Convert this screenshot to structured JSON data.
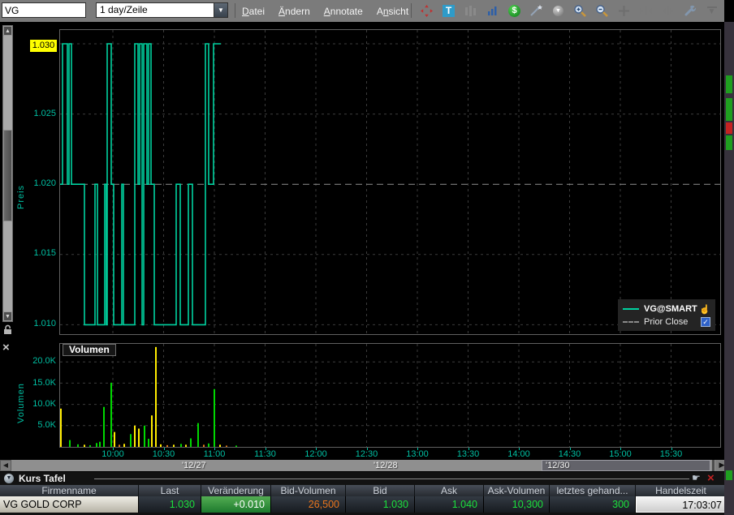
{
  "toolbar": {
    "symbol_value": "VG",
    "timeframe_value": "1 day/Zeile",
    "menus": [
      {
        "label": "Datei",
        "hotkey_index": 0
      },
      {
        "label": "Ändern",
        "hotkey_index": 0
      },
      {
        "label": "Annotate",
        "hotkey_index": 0
      },
      {
        "label": "Ansicht",
        "hotkey_index": 1
      }
    ],
    "icons": [
      "pan-icon",
      "text-annotate-icon",
      "bar-style-icon",
      "volume-style-icon",
      "dollar-icon",
      "trendline-icon",
      "trendline-menu-icon",
      "zoom-in-icon",
      "zoom-out-icon",
      "crosshair-icon",
      "expand-spacing-icon",
      "compress-spacing-icon",
      "settings-wrench-icon",
      "more-tools-icon"
    ]
  },
  "price_pane": {
    "ylabel": "Preis",
    "current_price_tag": "1.030",
    "ytick_labels": [
      "1.025",
      "1.020",
      "1.015",
      "1.010"
    ],
    "legend": {
      "series_label": "VG@SMART",
      "reference_label": "Prior Close",
      "reference_checked": true
    }
  },
  "volume_pane": {
    "title": "Volumen",
    "ylabel": "Volumen",
    "ytick_labels": [
      "20.0K",
      "15.0K",
      "10.0K",
      "5.0K"
    ]
  },
  "time_axis": {
    "labels": [
      "10:00",
      "10:30",
      "11:00",
      "11:30",
      "12:00",
      "12:30",
      "13:00",
      "13:30",
      "14:00",
      "14:30",
      "15:00",
      "15:30"
    ]
  },
  "date_axis": {
    "labels": [
      {
        "text": "'12/27",
        "x": 224
      },
      {
        "text": "'12/28",
        "x": 460
      },
      {
        "text": "'12/30",
        "x": 672
      }
    ]
  },
  "quote_panel": {
    "title": "Kurs Tafel",
    "columns": [
      "Firmenname",
      "Last",
      "Veränderung",
      "Bid-Volumen",
      "Bid",
      "Ask",
      "Ask-Volumen",
      "letztes gehand...",
      "Handelszeit"
    ],
    "row": {
      "firmenname": "VG GOLD CORP",
      "last": "1.030",
      "veraenderung": "+0.010",
      "bid_volumen": "26,500",
      "bid": "1.030",
      "ask": "1.040",
      "ask_volumen": "10,300",
      "letztes_gehandelt": "300",
      "handelszeit": "17:03:07"
    }
  },
  "colors": {
    "line_teal": "#00d2a0",
    "axis_teal": "#00bfa2",
    "bar_green": "#00d800",
    "bar_yellow": "#ffec00",
    "bar_orange": "#e07818",
    "quote_green": "#1be03c",
    "quote_orange": "#e8741c",
    "change_bg_green": "#2f9e3f",
    "tag_yellow": "#ffff00"
  },
  "chart_data": [
    {
      "type": "line",
      "title": "Preis",
      "ylim": [
        1.008,
        1.0315
      ],
      "yticks": [
        1.03,
        1.025,
        1.02,
        1.015,
        1.01
      ],
      "reference": {
        "name": "Prior Close",
        "value": 1.02
      },
      "tick_x": [
        66,
        128.5,
        191,
        253.5,
        316,
        378.5,
        441,
        503.5,
        566,
        628.5,
        691,
        753.5
      ],
      "series": [
        {
          "name": "VG@SMART",
          "end_x": 199,
          "step_points": [
            [
              0,
              1.02
            ],
            [
              4,
              1.03
            ],
            [
              10,
              1.02
            ],
            [
              12,
              1.03
            ],
            [
              15,
              1.02
            ],
            [
              31,
              1.01
            ],
            [
              44,
              1.02
            ],
            [
              47,
              1.01
            ],
            [
              56,
              1.02
            ],
            [
              58,
              1.01
            ],
            [
              59,
              1.03
            ],
            [
              64,
              1.02
            ],
            [
              67,
              1.01
            ],
            [
              77,
              1.02
            ],
            [
              79,
              1.01
            ],
            [
              93,
              1.03
            ],
            [
              97,
              1.02
            ],
            [
              99,
              1.03
            ],
            [
              102,
              1.01
            ],
            [
              104,
              1.03
            ],
            [
              108,
              1.02
            ],
            [
              110,
              1.03
            ],
            [
              113,
              1.02
            ],
            [
              117,
              1.01
            ],
            [
              144,
              1.02
            ],
            [
              149,
              1.01
            ],
            [
              159,
              1.02
            ],
            [
              164,
              1.01
            ],
            [
              180,
              1.03
            ],
            [
              184,
              1.02
            ],
            [
              190,
              1.03
            ]
          ]
        }
      ]
    },
    {
      "type": "bar",
      "title": "Volumen",
      "ylim": [
        0,
        24000
      ],
      "yticks": [
        5000,
        10000,
        15000,
        20000
      ],
      "bars": [
        {
          "x": 1,
          "v": 9.0,
          "c": "y"
        },
        {
          "x": 12,
          "v": 1.6,
          "c": "g"
        },
        {
          "x": 22,
          "v": 0.6,
          "c": "g"
        },
        {
          "x": 30,
          "v": 0.5,
          "c": "y"
        },
        {
          "x": 37,
          "v": 0.4,
          "c": "g"
        },
        {
          "x": 45,
          "v": 0.9,
          "c": "g"
        },
        {
          "x": 49,
          "v": 1.2,
          "c": "g"
        },
        {
          "x": 54,
          "v": 9.4,
          "c": "g"
        },
        {
          "x": 63,
          "v": 15.1,
          "c": "g"
        },
        {
          "x": 67,
          "v": 3.5,
          "c": "y"
        },
        {
          "x": 73,
          "v": 0.5,
          "c": "o"
        },
        {
          "x": 79,
          "v": 0.7,
          "c": "y"
        },
        {
          "x": 87,
          "v": 3.0,
          "c": "g"
        },
        {
          "x": 92,
          "v": 5.0,
          "c": "y"
        },
        {
          "x": 97,
          "v": 4.3,
          "c": "y"
        },
        {
          "x": 104,
          "v": 5.0,
          "c": "g"
        },
        {
          "x": 109,
          "v": 1.9,
          "c": "g"
        },
        {
          "x": 113,
          "v": 7.4,
          "c": "y"
        },
        {
          "x": 118,
          "v": 23.5,
          "c": "y"
        },
        {
          "x": 124,
          "v": 0.6,
          "c": "y"
        },
        {
          "x": 132,
          "v": 0.4,
          "c": "o"
        },
        {
          "x": 140,
          "v": 0.5,
          "c": "y"
        },
        {
          "x": 149,
          "v": 0.7,
          "c": "g"
        },
        {
          "x": 155,
          "v": 0.5,
          "c": "y"
        },
        {
          "x": 161,
          "v": 2.0,
          "c": "g"
        },
        {
          "x": 170,
          "v": 5.6,
          "c": "g"
        },
        {
          "x": 177,
          "v": 0.5,
          "c": "o"
        },
        {
          "x": 183,
          "v": 0.8,
          "c": "g"
        },
        {
          "x": 190,
          "v": 13.6,
          "c": "g"
        },
        {
          "x": 197,
          "v": 0.5,
          "c": "y"
        },
        {
          "x": 205,
          "v": 0.3,
          "c": "o"
        },
        {
          "x": 217,
          "v": 0.3,
          "c": "g"
        }
      ]
    }
  ]
}
